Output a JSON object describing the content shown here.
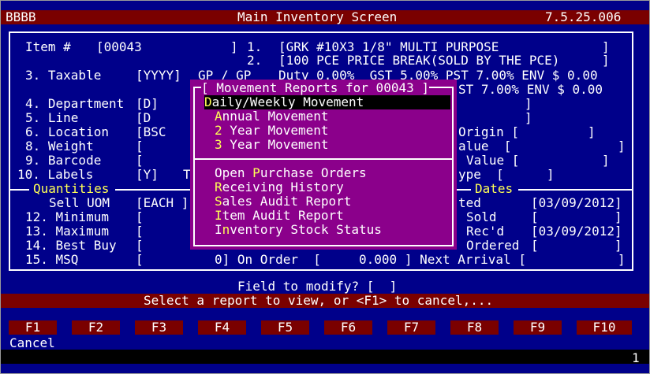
{
  "header": {
    "company": "BBBB",
    "title": "Main Inventory Screen",
    "version": "7.5.25.006"
  },
  "item": {
    "item_label": "Item #",
    "item_value": "[00043",
    "item_close": "]",
    "desc1_num": "1.",
    "desc1_value": "[GRK #10X3 1/8\" MULTI PURPOSE",
    "desc1_close": "]",
    "desc2_num": "2.",
    "desc2_value": "[100 PCE PRICE BREAK(SOLD BY THE PCE)",
    "desc2_close": "]"
  },
  "taxable": {
    "label": "3. Taxable",
    "value": "[YYYY]",
    "gp": "GP / GP",
    "rates": "Duty 0.00%  GST 5.00% PST 7.00% ENV $ 0.00",
    "rates2": "ST 7.00% ENV $ 0.00"
  },
  "fields": {
    "department": {
      "label": "4. Department",
      "value": "[D]",
      "close": "]"
    },
    "line": {
      "label": "5. Line",
      "value": "[D",
      "close": "]"
    },
    "location": {
      "label": "6. Location",
      "value": "[BSC",
      "right": "Origin [",
      "close": "]"
    },
    "weight": {
      "label": "8. Weight",
      "value": "[",
      "right": "alue  [",
      "close": "]"
    },
    "barcode": {
      "label": "9. Barcode",
      "value": "[",
      "right": "Value [",
      "close": "]"
    },
    "labels": {
      "label": "10. Labels",
      "value": "[Y]",
      "extra": "T",
      "right": "ype  [",
      "close": "]"
    }
  },
  "quantities": {
    "title": "Quantities",
    "sell_uom_label": "Sell UOM",
    "sell_uom_value": "[EACH ]",
    "minimum": {
      "label": "12. Minimum",
      "value": "["
    },
    "maximum": {
      "label": "13. Maximum",
      "value": "["
    },
    "best_buy": {
      "label": "14. Best Buy",
      "value": "["
    },
    "msq": {
      "label": "15. MSQ",
      "value": "["
    },
    "on_order_row": "0] On Order  [     0.000 ] Next Arrival ["
  },
  "dates": {
    "title": "Dates",
    "created_label": "ted",
    "created_value": "[03/09/2012]",
    "sold_label": "Sold",
    "sold_value": "[          ]",
    "received_label": "Rec'd",
    "received_value": "[03/09/2012]",
    "ordered_label": "Ordered",
    "ordered_value": "[          ]",
    "next_arrival_close": "]"
  },
  "popup": {
    "title": "[ Movement Reports for 00043 ]",
    "items": [
      {
        "hotkey": "D",
        "rest": "aily/Weekly Movement",
        "selected": true
      },
      {
        "hotkey": "A",
        "rest": "nnual Movement"
      },
      {
        "hotkey": "2",
        "rest": " Year Movement"
      },
      {
        "hotkey": "3",
        "rest": " Year Movement"
      },
      {
        "prefix": "Open ",
        "hotkey": "P",
        "rest": "urchase Orders"
      },
      {
        "hotkey": "R",
        "rest": "eceiving History"
      },
      {
        "hotkey": "S",
        "rest": "ales Audit Report"
      },
      {
        "hotkey": "I",
        "rest": "tem Audit Report"
      },
      {
        "prefix": "I",
        "hotkey": "n",
        "rest": "ventory Stock Status"
      }
    ]
  },
  "prompt": {
    "field_to_modify": "Field to modify? [  ]",
    "instruction": "Select a report to view, or <F1> to cancel,..."
  },
  "fkeys": [
    "F1",
    "F2",
    "F3",
    "F4",
    "F5",
    "F6",
    "F7",
    "F8",
    "F9",
    "F10"
  ],
  "status": {
    "cancel": "Cancel",
    "page": "1"
  },
  "colors": {
    "background": "#00008a",
    "bar": "#7a0000",
    "popup": "#8b008b",
    "hotkey": "#ffff55"
  }
}
